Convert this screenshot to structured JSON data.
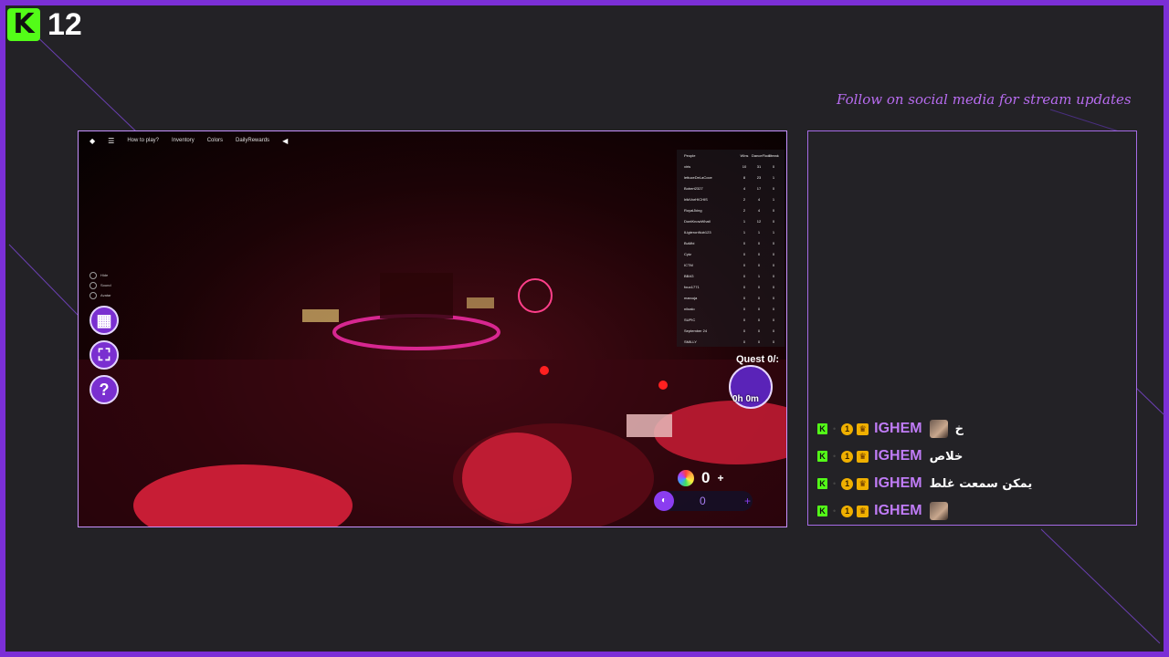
{
  "viewer_badge": {
    "logo": "K",
    "count": "12"
  },
  "social_banner": "Follow on social media for stream updates",
  "game": {
    "topbar": {
      "menu_icon": "hamburger-icon",
      "items": [
        "How to play?",
        "Inventory",
        "Colors",
        "DailyRewards"
      ]
    },
    "leaderboard": {
      "headers": [
        "People",
        "Wins",
        "DanceFloor",
        "Streak"
      ],
      "rows": [
        [
          "xiris",
          "10",
          "31",
          "0"
        ],
        [
          "lettuceDeLaCoce",
          "8",
          "23",
          "1"
        ],
        [
          "Bobert2327",
          "4",
          "17",
          "0"
        ],
        [
          "IrikiVorHICHIS",
          "2",
          "4",
          "1"
        ],
        [
          "RoyalJking",
          "2",
          "4",
          "0"
        ],
        [
          "DontKnowWhatl",
          "1",
          "12",
          "0"
        ],
        [
          "ILlgteronNub123",
          "1",
          "1",
          "1"
        ],
        [
          "BuMbi",
          "0",
          "0",
          "0"
        ],
        [
          "Cytz",
          "0",
          "0",
          "0"
        ],
        [
          "ICTM",
          "0",
          "0",
          "0"
        ],
        [
          "BB4G",
          "0",
          "1",
          "0"
        ],
        [
          "fouo1771",
          "0",
          "0",
          "0"
        ],
        [
          "marcuja",
          "0",
          "0",
          "0"
        ],
        [
          "niloalo",
          "0",
          "0",
          "0"
        ],
        [
          "SUPIC",
          "0",
          "0",
          "0"
        ],
        [
          "September 24",
          "0",
          "0",
          "0"
        ],
        [
          "SMILLY",
          "0",
          "0",
          "0"
        ]
      ]
    },
    "side_toggles": [
      "Hide",
      "Sound",
      "Avatar"
    ],
    "side_buttons": [
      {
        "icon": "cube-icon",
        "glyph": "▦"
      },
      {
        "icon": "frame-icon",
        "glyph": "⛶"
      },
      {
        "icon": "help-icon",
        "glyph": "?"
      }
    ],
    "quest": {
      "label": "Quest 0/:",
      "timer": "0h 0m"
    },
    "currency": {
      "value": "0",
      "plus": "+"
    },
    "bar": {
      "value": "0",
      "plus": "+"
    }
  },
  "chat": {
    "messages": [
      {
        "user": "IGHEM",
        "text": "خ",
        "emote": true
      },
      {
        "user": "IGHEM",
        "text": "خلاص",
        "emote": false
      },
      {
        "user": "IGHEM",
        "text": "يمكن سمعت غلط",
        "emote": false
      },
      {
        "user": "IGHEM",
        "text": "",
        "emote": true
      }
    ],
    "badges": {
      "platform": "K",
      "sub": "1",
      "crown": "♛"
    }
  },
  "colors": {
    "accent": "#7b2fd6",
    "kick_green": "#53fc18",
    "username": "#c07cf7"
  }
}
